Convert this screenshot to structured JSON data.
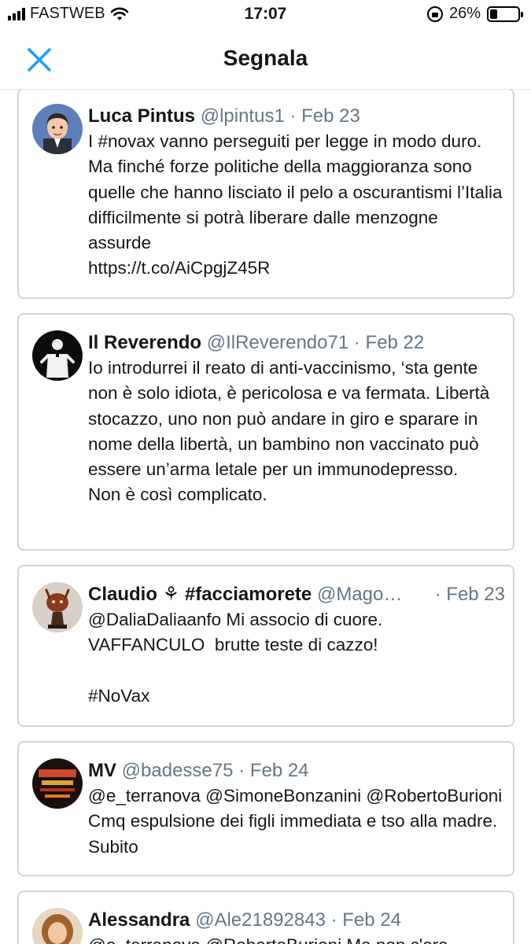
{
  "status_bar": {
    "carrier": "FASTWEB",
    "time": "17:07",
    "battery_percent": "26%",
    "battery_level": 0.26
  },
  "nav": {
    "title": "Segnala",
    "close_icon": "close-icon",
    "accent_color": "#1da1f2"
  },
  "tweets": [
    {
      "name": "Luca Pintus",
      "handle": "@lpintus1",
      "date": "Feb 23",
      "text": "I #novax vanno perseguiti per legge in modo duro. Ma finché forze politiche della maggioranza sono quelle che hanno lisciato il pelo a oscurantismi l’Italia difficilmente si potrà liberare dalle menzogne assurde\nhttps://t.co/AiCpgjZ45R"
    },
    {
      "name": "Il Reverendo",
      "handle": "@IlReverendo71",
      "date": "Feb 22",
      "text": "Io introdurrei il reato di anti-vaccinismo, ‘sta gente non è solo idiota, è pericolosa e va fermata. Libertà stocazzo, uno non può andare in giro e sparare in nome della libertà, un bambino non vaccinato può essere un’arma letale per un immunodepresso.\nNon è così complicato."
    },
    {
      "name": "Claudio ⚘ #facciamorete",
      "handle": "@Mago…",
      "date": "Feb 23",
      "text": "@DaliaDaliaanfo Mi associo di cuore.\nVAFFANCULO  brutte teste di cazzo!\n\n#NoVax"
    },
    {
      "name": "MV",
      "handle": "@badesse75",
      "date": "Feb 24",
      "text": "@e_terranova @SimoneBonzanini @RobertoBurioni Cmq espulsione dei figli immediata e tso alla madre. Subito"
    },
    {
      "name": "Alessandra",
      "handle": "@Ale21892843",
      "date": "Feb 24",
      "text": "@e_terranova @RobertoBurioni Ma non c'era"
    }
  ]
}
